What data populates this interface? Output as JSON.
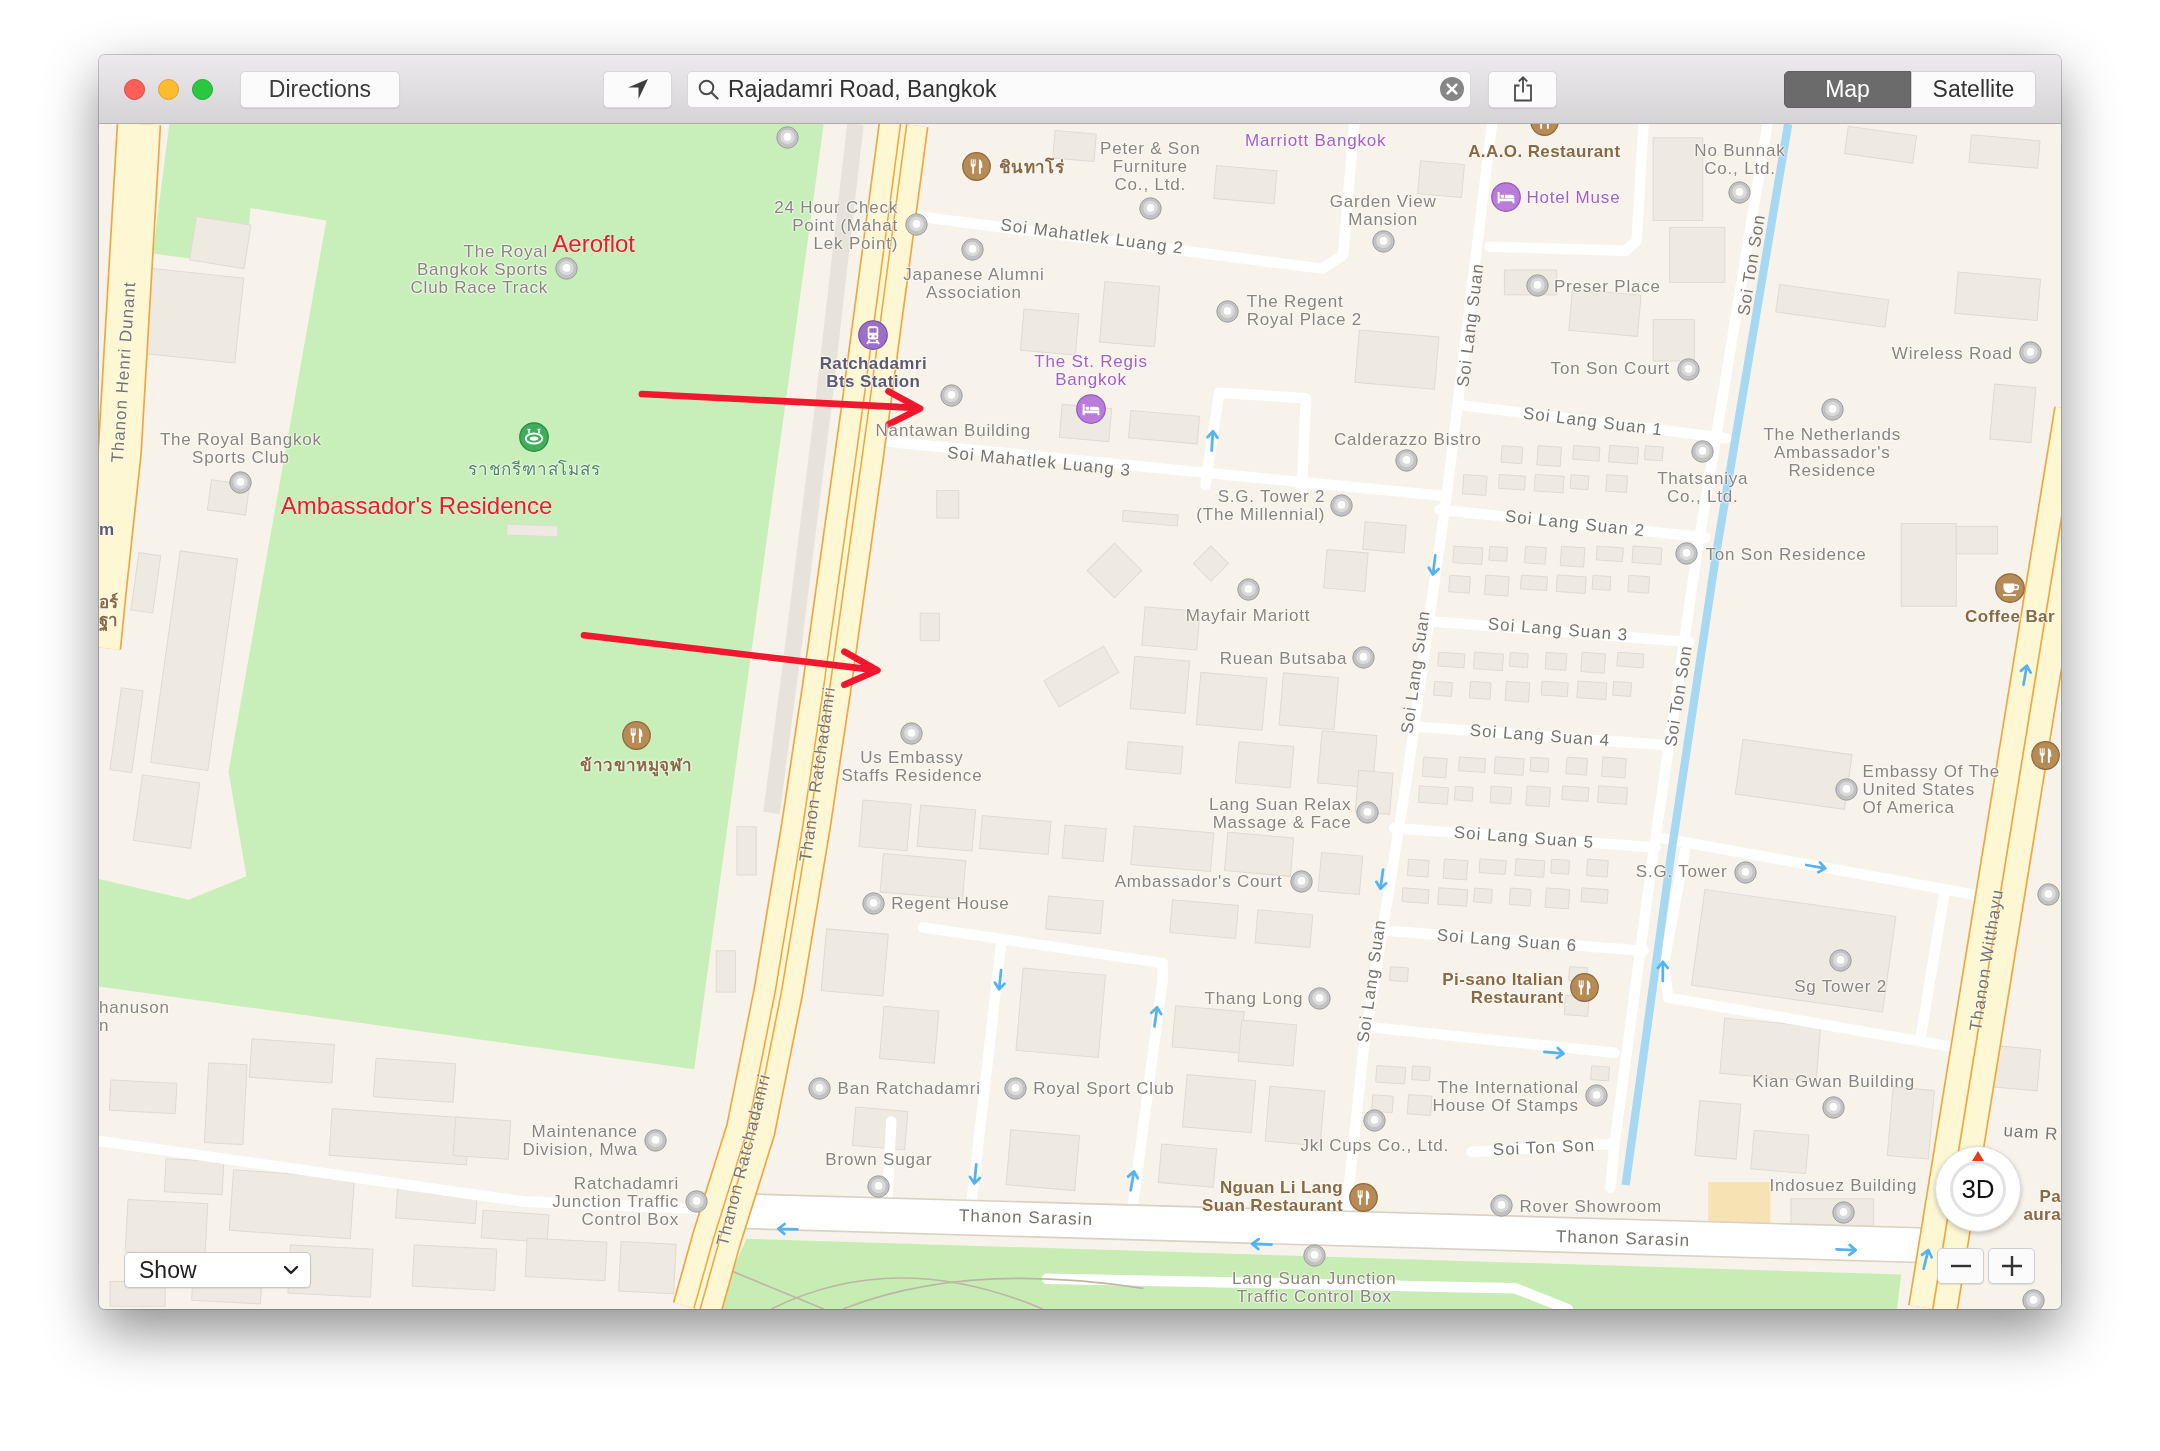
{
  "toolbar": {
    "directions_button": "Directions",
    "search": {
      "value": "Rajadamri Road, Bangkok"
    },
    "view_modes": [
      {
        "label": "Map",
        "selected": true
      },
      {
        "label": "Satellite",
        "selected": false
      }
    ]
  },
  "map": {
    "places": [
      {
        "kind": "pin"
      },
      {
        "name": "ชินทาโร่",
        "kind": "restaurant"
      },
      {
        "name": "Peter & Son Furniture Co., Ltd.",
        "kind": "pin"
      },
      {
        "name": "Marriott Bangkok",
        "kind": "hotel"
      },
      {
        "name": "A.A.O. Restaurant",
        "kind": "restaurant"
      },
      {
        "name": "No Bunnak Co., Ltd.",
        "kind": "pin"
      },
      {
        "name": "24 Hour Check Point (Mahat Lek Point)",
        "kind": "pin"
      },
      {
        "name": "Garden View Mansion",
        "kind": "pin"
      },
      {
        "name": "Hotel Muse",
        "kind": "hotel"
      },
      {
        "name": "The Royal Bangkok Sports Club Race Track",
        "kind": "pin"
      },
      {
        "name": "Japanese Alumni Association",
        "kind": "pin"
      },
      {
        "name": "Preser Place",
        "kind": "pin"
      },
      {
        "name": "The Regent Royal Place 2",
        "kind": "pin"
      },
      {
        "name": "Ratchadamri Bts Station",
        "kind": "transit"
      },
      {
        "name": "The St. Regis Bangkok",
        "kind": "hotel"
      },
      {
        "name": "Ton Son Court",
        "kind": "pin"
      },
      {
        "name": "Wireless Road",
        "kind": "pin"
      },
      {
        "name": "The Royal Bangkok Sports Club",
        "kind": "pin"
      },
      {
        "name": "Nantawan Building",
        "kind": "pin"
      },
      {
        "name": "Calderazzo Bistro",
        "kind": "pin"
      },
      {
        "name": "ราชกรีฑาสโมสร",
        "kind": "stadium"
      },
      {
        "name": "The Netherlands Ambassador's Residence",
        "kind": "pin"
      },
      {
        "name": "S.G. Tower 2 (The Millennial)",
        "kind": "pin"
      },
      {
        "name": "Thatsaniya Co., Ltd.",
        "kind": "pin"
      },
      {
        "name": "m",
        "kind": "transit"
      },
      {
        "name": "Ton Son Residence",
        "kind": "pin"
      },
      {
        "name": "อร์ ฐา",
        "kind": "restaurant"
      },
      {
        "name": "Mayfair Mariott",
        "kind": "pin"
      },
      {
        "name": "Coffee Bar",
        "kind": "cafe"
      },
      {
        "name": "Ruean Butsaba",
        "kind": "pin"
      },
      {
        "name": "ข้าวขาหมูจุฬา",
        "kind": "restaurant"
      },
      {
        "name": "Us Embassy Staffs Residence",
        "kind": "pin"
      },
      {
        "kind": "restaurant"
      },
      {
        "name": "Lang Suan Relax Massage & Face",
        "kind": "pin"
      },
      {
        "name": "Embassy Of The United States Of America",
        "kind": "pin"
      },
      {
        "name": "Ambassador's Court",
        "kind": "pin"
      },
      {
        "name": "S.G. Tower",
        "kind": "pin"
      },
      {
        "name": "Regent House",
        "kind": "pin"
      },
      {
        "kind": "pin"
      },
      {
        "name": "hanuson n",
        "kind": "pin"
      },
      {
        "name": "Thang Long",
        "kind": "pin"
      },
      {
        "name": "Pi-sano Italian Restaurant",
        "kind": "restaurant"
      },
      {
        "name": "Sg Tower 2",
        "kind": "pin"
      },
      {
        "name": "Ban Ratchadamri",
        "kind": "pin"
      },
      {
        "name": "Royal Sport Club",
        "kind": "pin"
      },
      {
        "name": "The International House Of Stamps",
        "kind": "pin"
      },
      {
        "name": "Kian Gwan Building",
        "kind": "pin"
      },
      {
        "name": "Maintenance Division, Mwa",
        "kind": "pin"
      },
      {
        "name": "Brown Sugar",
        "kind": "pin"
      },
      {
        "name": "Jkl Cups Co., Ltd.",
        "kind": "pin"
      },
      {
        "name": "Ratchadamri Junction Traffic Control Box",
        "kind": "pin"
      },
      {
        "name": "Nguan Li Lang Suan Restaurant",
        "kind": "restaurant"
      },
      {
        "name": "Indosuez Building",
        "kind": "pin"
      },
      {
        "name": "Rover Showroom",
        "kind": "pin"
      },
      {
        "name": "Pa aura",
        "kind": "restaurant"
      },
      {
        "name": "Lang Suan Junction Traffic Control Box",
        "kind": "pin"
      },
      {
        "kind": "pin"
      }
    ],
    "streets": [
      {
        "name": "Soi Mahatlek Luang 2"
      },
      {
        "name": "Thanon Henri Dunant"
      },
      {
        "name": "Soi Lang Suan"
      },
      {
        "name": "Soi Ton Son"
      },
      {
        "name": "Soi Lang Suan 1"
      },
      {
        "name": "Soi Mahatlek Luang 3"
      },
      {
        "name": "Soi Lang Suan 2"
      },
      {
        "name": "Thanon Ratchadamri"
      },
      {
        "name": "Soi Lang Suan"
      },
      {
        "name": "Soi Lang Suan 3"
      },
      {
        "name": "Soi Lang Suan 4"
      },
      {
        "name": "Soi Ton Son"
      },
      {
        "name": "Soi Lang Suan 5"
      },
      {
        "name": "Soi Lang Suan"
      },
      {
        "name": "Soi Lang Suan 6"
      },
      {
        "name": "Thanon Witthayu"
      },
      {
        "name": "Thanon Ratchadamri"
      },
      {
        "name": "Soi Ton Son"
      },
      {
        "name": "uam R"
      },
      {
        "name": "Thanon Sarasin"
      },
      {
        "name": "Thanon Sarasin"
      }
    ],
    "annotations": [
      {
        "text": "Aeroflot"
      },
      {
        "text": "Ambassador's Residence"
      }
    ]
  },
  "controls": {
    "show_menu": "Show",
    "compass_label": "3D"
  }
}
